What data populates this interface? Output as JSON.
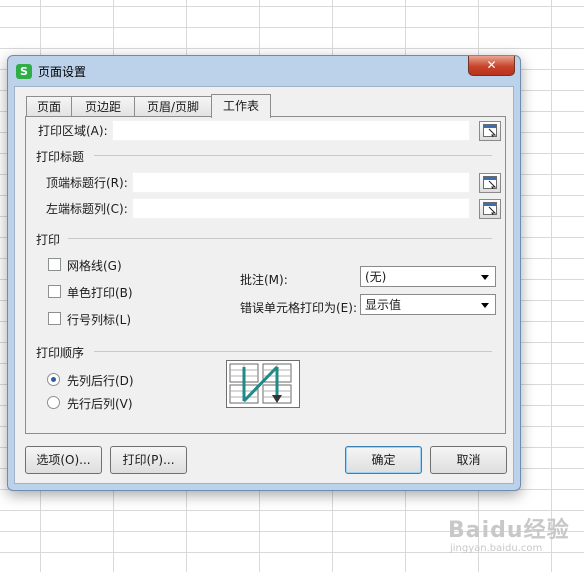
{
  "window": {
    "title": "页面设置",
    "app_icon": "S",
    "close_label": "✕"
  },
  "tabs": [
    {
      "label": "页面",
      "active": false
    },
    {
      "label": "页边距",
      "active": false
    },
    {
      "label": "页眉/页脚",
      "active": false
    },
    {
      "label": "工作表",
      "active": true
    }
  ],
  "print_area": {
    "label": "打印区域(A):",
    "value": ""
  },
  "print_titles": {
    "section": "打印标题",
    "top_rows_label": "顶端标题行(R):",
    "top_rows_value": "",
    "left_cols_label": "左端标题列(C):",
    "left_cols_value": ""
  },
  "print": {
    "section": "打印",
    "gridlines": {
      "label": "网格线(G)",
      "checked": false
    },
    "mono": {
      "label": "单色打印(B)",
      "checked": false
    },
    "headings": {
      "label": "行号列标(L)",
      "checked": false
    },
    "comments_label": "批注(M):",
    "comments_value": "(无)",
    "errors_label": "错误单元格打印为(E):",
    "errors_value": "显示值"
  },
  "order": {
    "section": "打印顺序",
    "down_then_over": {
      "label": "先列后行(D)",
      "selected": true
    },
    "over_then_down": {
      "label": "先行后列(V)",
      "selected": false
    }
  },
  "buttons": {
    "options": "选项(O)...",
    "print": "打印(P)...",
    "ok": "确定",
    "cancel": "取消"
  },
  "watermark": {
    "text": "Baidu经验",
    "sub": "jingyan.baidu.com"
  }
}
